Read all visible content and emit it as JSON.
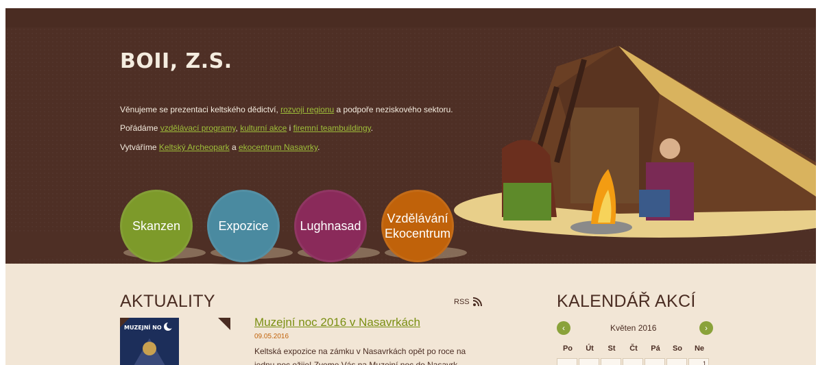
{
  "site": {
    "title": "BOII, Z.S.",
    "intro_lines": [
      {
        "parts": [
          {
            "text": "Věnujeme se prezentaci keltského dědictví, ",
            "link": false
          },
          {
            "text": "rozvoji regionu",
            "link": true
          },
          {
            "text": " a podpoře neziskového sektoru.",
            "link": false
          }
        ]
      },
      {
        "parts": [
          {
            "text": "Pořádáme ",
            "link": false
          },
          {
            "text": "vzdělávací programy",
            "link": true
          },
          {
            "text": ", ",
            "link": false
          },
          {
            "text": "kulturní akce",
            "link": true
          },
          {
            "text": " i ",
            "link": false
          },
          {
            "text": "firemní teambuildingy",
            "link": true
          },
          {
            "text": ".",
            "link": false
          }
        ]
      },
      {
        "parts": [
          {
            "text": "Vytváříme ",
            "link": false
          },
          {
            "text": "Keltský Archeopark",
            "link": true
          },
          {
            "text": " a ",
            "link": false
          },
          {
            "text": "ekocentrum Nasavrky",
            "link": true
          },
          {
            "text": ".",
            "link": false
          }
        ]
      }
    ]
  },
  "circles": {
    "skanzen": "Skanzen",
    "expozice": "Expozice",
    "lughnasad": "Lughnasad",
    "vzdelavani": "Vzdělávání",
    "ekocentrum": "Ekocentrum"
  },
  "news": {
    "heading": "AKTUALITY",
    "rss_label": "RSS",
    "image_label": "MUZEJNÍ NO",
    "item": {
      "title": "Muzejní noc 2016 v Nasavrkách",
      "date": "09.05.2016",
      "excerpt": "Keltská expozice na zámku v Nasavrkách opět po roce na jednu noc ožije! Zveme Vás na Muzejní noc do Nasavrk."
    }
  },
  "calendar": {
    "heading": "KALENDÁŘ AKCÍ",
    "month": "Květen 2016",
    "prev_label": "‹",
    "next_label": "›",
    "days": [
      "Po",
      "Út",
      "St",
      "Čt",
      "Pá",
      "So",
      "Ne"
    ],
    "first_row": [
      "",
      "",
      "",
      "",
      "",
      "",
      "1"
    ]
  },
  "colors": {
    "hero_bg": "#4e2f25",
    "accent_link": "#9fbf3a",
    "skanzen": "#7d9a2a",
    "expozice": "#4a8aa0",
    "lughnasad": "#8a2a5a",
    "vzdelavani": "#c0620a"
  }
}
